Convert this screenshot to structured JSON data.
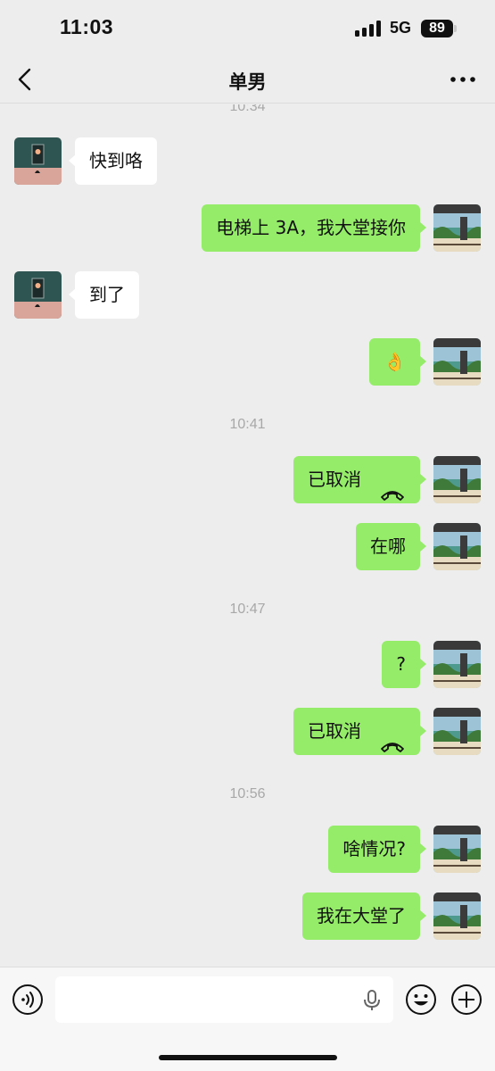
{
  "status_bar": {
    "time": "11:03",
    "network": "5G",
    "battery": "89"
  },
  "header": {
    "title": "单男",
    "back_icon": "chevron-left-icon",
    "more_icon": "more-dots-icon"
  },
  "chat": {
    "top_partial_timestamp": "10:34",
    "messages": [
      {
        "side": "in",
        "text": "快到咯"
      },
      {
        "side": "out",
        "text": "电梯上 3A，我大堂接你"
      },
      {
        "side": "in",
        "text": "到了"
      },
      {
        "side": "out",
        "text": "👌"
      },
      {
        "timestamp": "10:41"
      },
      {
        "side": "out",
        "text": "已取消",
        "call": true
      },
      {
        "side": "out",
        "text": "在哪"
      },
      {
        "timestamp": "10:47"
      },
      {
        "side": "out",
        "text": "?"
      },
      {
        "side": "out",
        "text": "已取消",
        "call": true
      },
      {
        "timestamp": "10:56"
      },
      {
        "side": "out",
        "text": "啥情况?"
      },
      {
        "side": "out",
        "text": "我在大堂了"
      }
    ]
  },
  "input_bar": {
    "value": "",
    "voice_icon": "voice-input-icon",
    "mic_icon": "microphone-icon",
    "emoji_icon": "emoji-icon",
    "plus_icon": "plus-icon"
  },
  "colors": {
    "background": "#ededed",
    "outgoing_bubble": "#95ec69",
    "incoming_bubble": "#ffffff",
    "timestamp": "#a8a8a8"
  }
}
